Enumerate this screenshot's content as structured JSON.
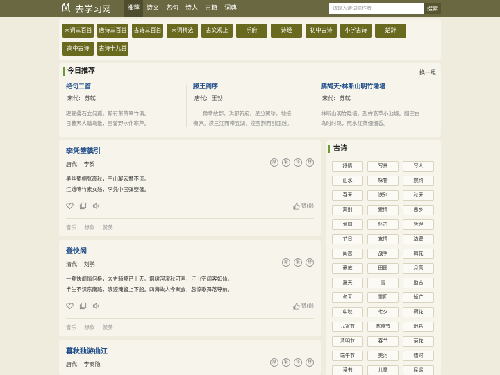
{
  "header": {
    "site_name": "去学习网",
    "nav": [
      "推荐",
      "诗文",
      "名句",
      "诗人",
      "古籍",
      "词典"
    ],
    "search_placeholder": "请输入诗词或作者",
    "search_button": "搜索"
  },
  "categories": [
    "宋词三百首",
    "唐诗三百首",
    "古诗三百首",
    "宋词精选",
    "古文观止",
    "乐府",
    "诗经",
    "初中古诗",
    "小学古诗",
    "楚辞",
    "高中古诗",
    "古诗十九首"
  ],
  "today": {
    "heading": "今日推荐",
    "change": "换一组",
    "poems": [
      {
        "title": "绝句二首",
        "dynasty": "宋代:",
        "author": "苏轼",
        "line1": "猩猩叠石立何孤，翰有萧萧翠竹俱。",
        "line2": "日暮天人鹃鸟散，空留野水伴寒芦。"
      },
      {
        "title": "滕王阁序",
        "dynasty": "唐代:",
        "author": "王勃",
        "line1": "豫章故郡，洪都新府。星分翼轸，地接",
        "line2": "衡庐。襟三江而带五湖，控蛮荆而引瓯越。"
      },
      {
        "title": "鹧鸪天·林断山明竹隐墙",
        "dynasty": "宋代:",
        "author": "苏轼",
        "line1": "林断山明竹隐墙。乱蝉衰草小池塘。翻空白",
        "line2": "鸟时时见，照水红蕖细细香。"
      }
    ]
  },
  "poems": [
    {
      "title": "李凭箜篌引",
      "dynasty": "唐代:",
      "author": "李贺",
      "badges": [
        "原",
        "繁",
        "译",
        "拼"
      ],
      "line1": "吴丝蜀桐张高秋，空山凝云颓不流。",
      "line2": "江娥啼竹素女愁，李凭中国弹箜篌。",
      "likes": "赞(0)",
      "tags": [
        "音乐",
        "想象",
        "赞美"
      ]
    },
    {
      "title": "登快阁",
      "dynasty": "清代:",
      "author": "刘鹗",
      "badges": [
        "原",
        "繁",
        "拼"
      ],
      "line1": "一登快阁情何极，太史骑鲸已上天。烟树溟濛秋可画，江山空阔客如仙。",
      "line2": "半生不识东南路，浪迹淹留上下船。四海故人今聚会，忽惊歌舞落尊前。",
      "likes": "赞(0)",
      "tags": [
        "音乐",
        "想象",
        "赞美"
      ]
    },
    {
      "title": "暮秋独游曲江",
      "dynasty": "唐代:",
      "author": "李商隐",
      "badges": [
        "原",
        "繁",
        "译",
        "拼"
      ],
      "line1": "",
      "line2": "",
      "likes": "",
      "tags": []
    }
  ],
  "sidebar": {
    "heading": "古诗",
    "tags": [
      "抒情",
      "写景",
      "写人",
      "山水",
      "咏物",
      "婉约",
      "春天",
      "送别",
      "秋天",
      "离别",
      "爱情",
      "思乡",
      "爱国",
      "怀古",
      "哲理",
      "节日",
      "友情",
      "边塞",
      "闺怨",
      "战争",
      "梅花",
      "豪放",
      "田园",
      "月亮",
      "夏天",
      "雪",
      "励志",
      "冬天",
      "重阳",
      "悼亡",
      "中秋",
      "七夕",
      "荷花",
      "元宵节",
      "寒食节",
      "地名",
      "清明节",
      "春节",
      "菊花",
      "端午节",
      "美河",
      "惜时",
      "读书",
      "儿童",
      "民谣"
    ]
  }
}
